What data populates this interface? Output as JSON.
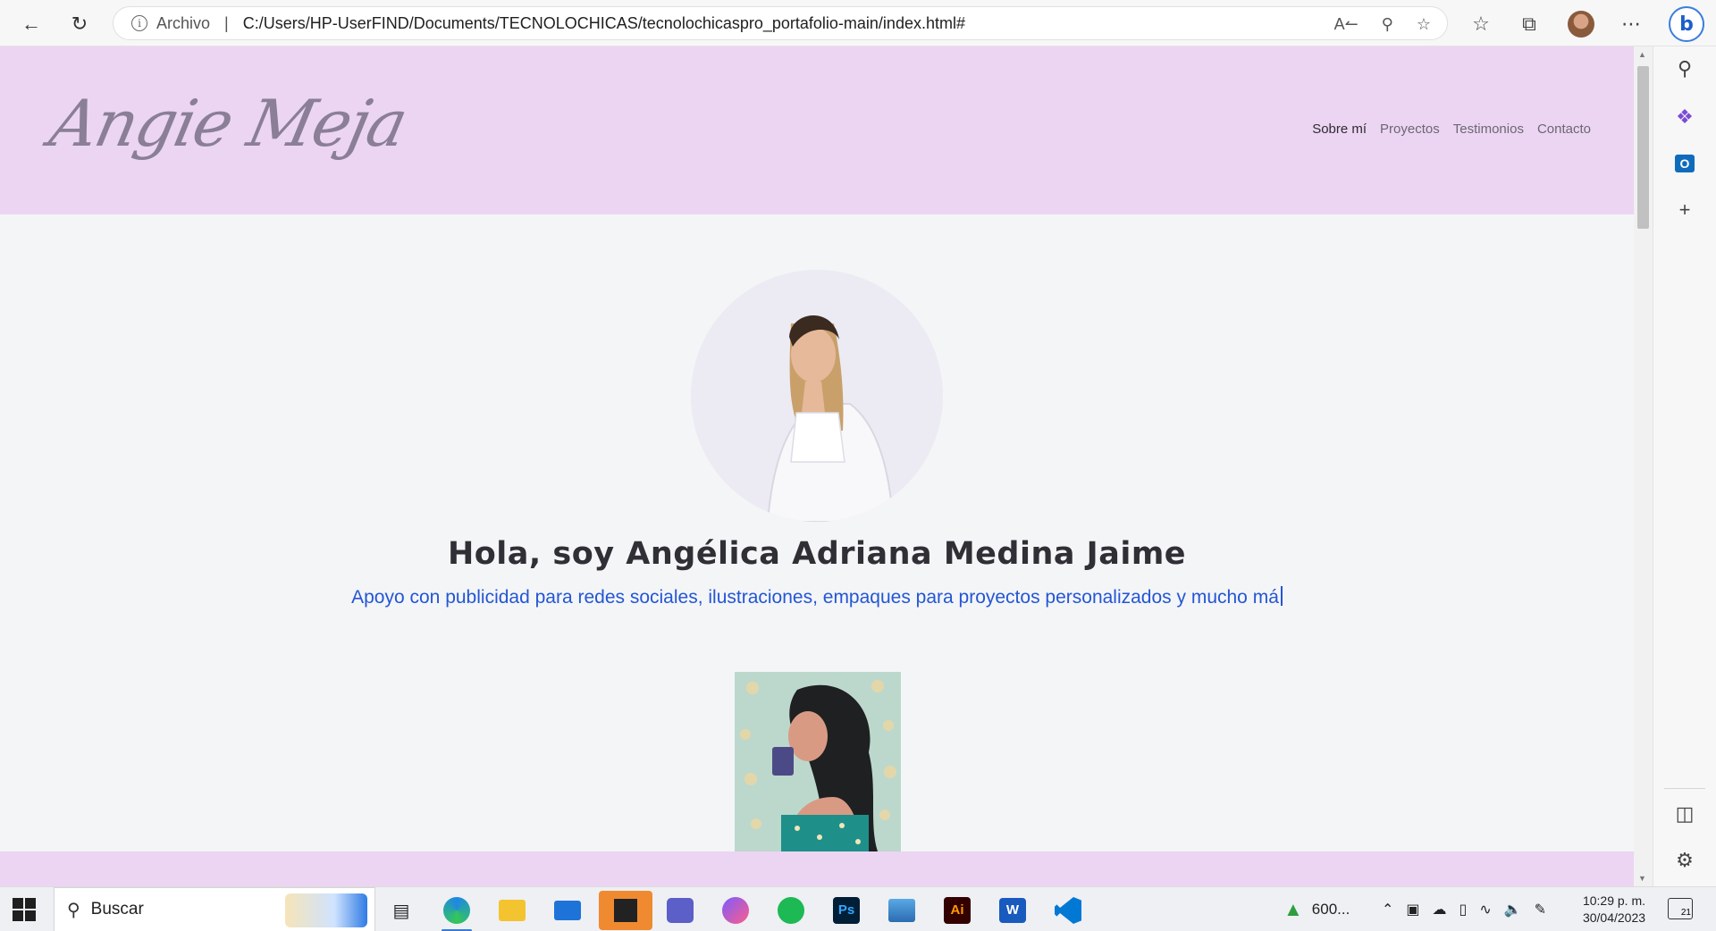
{
  "browser": {
    "address_label": "Archivo",
    "address_separator": "|",
    "url": "C:/Users/HP-UserFIND/Documents/TECNOLOCHICAS/tecnolochicaspro_portafolio-main/index.html#"
  },
  "site": {
    "logo_text": "Angie Meja",
    "nav": [
      {
        "label": "Sobre mí",
        "active": true
      },
      {
        "label": "Proyectos",
        "active": false
      },
      {
        "label": "Testimonios",
        "active": false
      },
      {
        "label": "Contacto",
        "active": false
      }
    ],
    "hero_title": "Hola, soy Angélica Adriana Medina Jaime",
    "hero_subtitle": "Apoyo con publicidad para redes sociales, ilustraciones, empaques para proyectos personalizados y mucho má",
    "colors": {
      "header_bg": "#ecd5f2",
      "subtitle": "#2356d4"
    }
  },
  "taskbar": {
    "search_placeholder": "Buscar",
    "stock_value": "600...",
    "time": "10:29 p. m.",
    "date": "30/04/2023",
    "notification_count": "21",
    "apps": [
      "task-view",
      "edge",
      "file-explorer",
      "mail",
      "sticky-notes",
      "teams",
      "messenger",
      "spotify",
      "photoshop",
      "photos",
      "illustrator",
      "word",
      "vscode"
    ],
    "app_labels": {
      "photoshop": "Ps",
      "illustrator": "Ai",
      "word": "W"
    }
  }
}
